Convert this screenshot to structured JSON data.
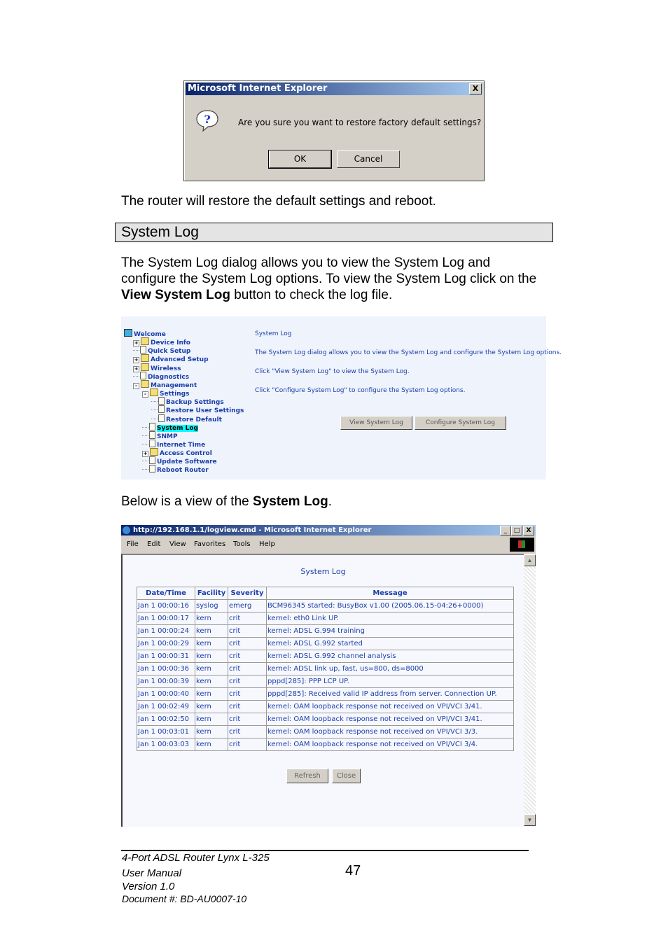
{
  "confirm_dialog": {
    "title": "Microsoft Internet Explorer",
    "close_label": "X",
    "icon": "question-icon",
    "message": "Are you sure you want to restore factory default settings?",
    "ok_label": "OK",
    "cancel_label": "Cancel"
  },
  "doc": {
    "para1": "The router will restore the default settings and reboot.",
    "section_title": "System Log",
    "para2_part1": "The System Log dialog allows you to view the System Log and configure the System Log options. To view the System Log click on the ",
    "para2_bold": "View System Log",
    "para2_part2": " button to check the log file.",
    "para3_part1": "Below is a view of the ",
    "para3_bold": "System Log",
    "para3_part2": "."
  },
  "router_ui": {
    "tree": [
      {
        "label": "Welcome",
        "icon": "computer-icon"
      },
      {
        "label": "Device Info",
        "icon": "folder-icon",
        "toggle": "+"
      },
      {
        "label": "Quick Setup",
        "icon": "page-icon"
      },
      {
        "label": "Advanced Setup",
        "icon": "folder-icon",
        "toggle": "+"
      },
      {
        "label": "Wireless",
        "icon": "folder-icon",
        "toggle": "+"
      },
      {
        "label": "Diagnostics",
        "icon": "page-icon"
      },
      {
        "label": "Management",
        "icon": "folder-open-icon",
        "toggle": "-"
      },
      {
        "label": "Settings",
        "icon": "folder-open-icon",
        "toggle": "-"
      },
      {
        "label": "Backup Settings",
        "icon": "page-icon"
      },
      {
        "label": "Restore User Settings",
        "icon": "page-icon"
      },
      {
        "label": "Restore Default",
        "icon": "page-icon"
      },
      {
        "label": "System Log",
        "icon": "page-icon",
        "selected": true
      },
      {
        "label": "SNMP",
        "icon": "page-icon"
      },
      {
        "label": "Internet Time",
        "icon": "page-icon"
      },
      {
        "label": "Access Control",
        "icon": "folder-icon",
        "toggle": "+"
      },
      {
        "label": "Update Software",
        "icon": "page-icon"
      },
      {
        "label": "Reboot Router",
        "icon": "page-icon"
      }
    ],
    "heading": "System Log",
    "desc1": "The System Log dialog allows you to view the System Log and configure the System Log options.",
    "desc2": "Click \"View System Log\" to view the System Log.",
    "desc3": "Click \"Configure System Log\" to configure the System Log options.",
    "view_button": "View System Log",
    "configure_button": "Configure System Log"
  },
  "log_window": {
    "title": "http://192.168.1.1/logview.cmd - Microsoft Internet Explorer",
    "menu": [
      "File",
      "Edit",
      "View",
      "Favorites",
      "Tools",
      "Help"
    ],
    "heading": "System Log",
    "columns": [
      "Date/Time",
      "Facility",
      "Severity",
      "Message"
    ],
    "rows": [
      [
        "Jan 1 00:00:16",
        "syslog",
        "emerg",
        "BCM96345 started: BusyBox v1.00 (2005.06.15-04:26+0000)"
      ],
      [
        "Jan 1 00:00:17",
        "kern",
        "crit",
        "kernel: eth0 Link UP."
      ],
      [
        "Jan 1 00:00:24",
        "kern",
        "crit",
        "kernel: ADSL G.994 training"
      ],
      [
        "Jan 1 00:00:29",
        "kern",
        "crit",
        "kernel: ADSL G.992 started"
      ],
      [
        "Jan 1 00:00:31",
        "kern",
        "crit",
        "kernel: ADSL G.992 channel analysis"
      ],
      [
        "Jan 1 00:00:36",
        "kern",
        "crit",
        "kernel: ADSL link up, fast, us=800, ds=8000"
      ],
      [
        "Jan 1 00:00:39",
        "kern",
        "crit",
        "pppd[285]: PPP LCP UP."
      ],
      [
        "Jan 1 00:00:40",
        "kern",
        "crit",
        "pppd[285]: Received valid IP address from server. Connection UP."
      ],
      [
        "Jan 1 00:02:49",
        "kern",
        "crit",
        "kernel: OAM loopback response not received on VPI/VCI 3/41."
      ],
      [
        "Jan 1 00:02:50",
        "kern",
        "crit",
        "kernel: OAM loopback response not received on VPI/VCI 3/41."
      ],
      [
        "Jan 1 00:03:01",
        "kern",
        "crit",
        "kernel: OAM loopback response not received on VPI/VCI 3/3."
      ],
      [
        "Jan 1 00:03:03",
        "kern",
        "crit",
        "kernel: OAM loopback response not received on VPI/VCI 3/4."
      ]
    ],
    "refresh_button": "Refresh",
    "close_button": "Close"
  },
  "footer": {
    "line1": "4-Port ADSL Router Lynx L-325",
    "line2": "User Manual",
    "line3": "Version 1.0",
    "line4": "Document #:  BD-AU0007-10",
    "page_number": "47"
  }
}
